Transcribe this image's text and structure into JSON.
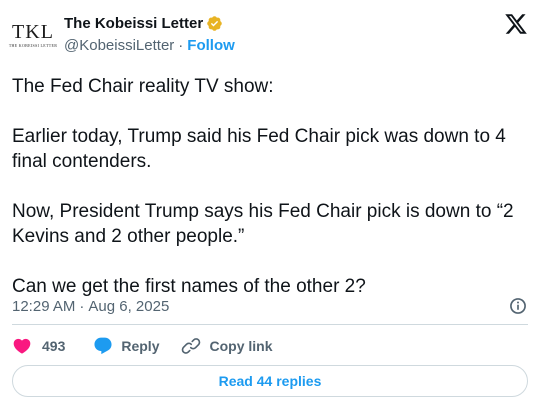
{
  "author": {
    "avatar_monogram": "TKL",
    "avatar_subtitle": "THE KOBEISSI LETTER",
    "display_name": "The Kobeissi Letter",
    "handle": "@KobeissiLetter",
    "separator": "·",
    "follow_label": "Follow",
    "verified_badge_color": "#e8b323"
  },
  "tweet": {
    "paragraphs": [
      "The Fed Chair reality TV show:",
      "Earlier today, Trump said his Fed Chair pick was down to 4 final contenders.",
      "Now, President Trump says his Fed Chair pick is down to “2 Kevins and 2 other people.”",
      "Can we get the first names of the other 2?"
    ],
    "time": "12:29 AM",
    "separator": "·",
    "date": "Aug 6, 2025"
  },
  "actions": {
    "like_count": "493",
    "reply_label": "Reply",
    "copy_link_label": "Copy link",
    "like_color": "#f91880",
    "reply_color": "#1d9bf0"
  },
  "footer": {
    "read_replies_label": "Read 44 replies"
  },
  "icons": {
    "verified": "verified-badge-icon",
    "x_logo": "x-logo-icon",
    "info": "info-icon",
    "like": "heart-icon",
    "reply": "reply-bubble-icon",
    "copy_link": "link-icon"
  }
}
